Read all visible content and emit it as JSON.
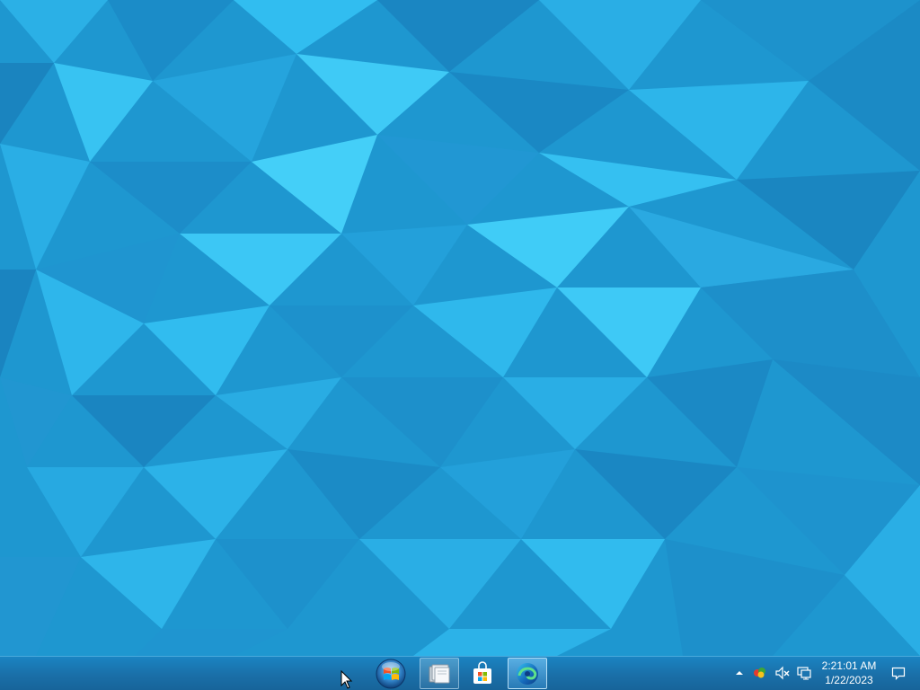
{
  "desktop": {
    "wallpaper": "blue-low-poly-triangles",
    "colors": {
      "base": "#1e97d0",
      "light": "#3cc2f2",
      "dark": "#1577b0",
      "mid": "#22a6de"
    }
  },
  "taskbar": {
    "colors": {
      "background": "#1a74b0",
      "border": "#49a9dc"
    },
    "pinned": [
      {
        "name": "start-button",
        "icon": "windows-orb-icon"
      },
      {
        "name": "file-explorer-button",
        "icon": "folder-icon"
      },
      {
        "name": "microsoft-store-button",
        "icon": "store-bag-icon"
      },
      {
        "name": "edge-button",
        "icon": "edge-icon",
        "active": true
      }
    ],
    "tray": {
      "icons": [
        "chevron-up-icon",
        "color-balls-icon",
        "speaker-muted-icon",
        "network-icon",
        "notification-icon"
      ],
      "time": "2:21:01 AM",
      "date": "1/22/2023"
    }
  }
}
